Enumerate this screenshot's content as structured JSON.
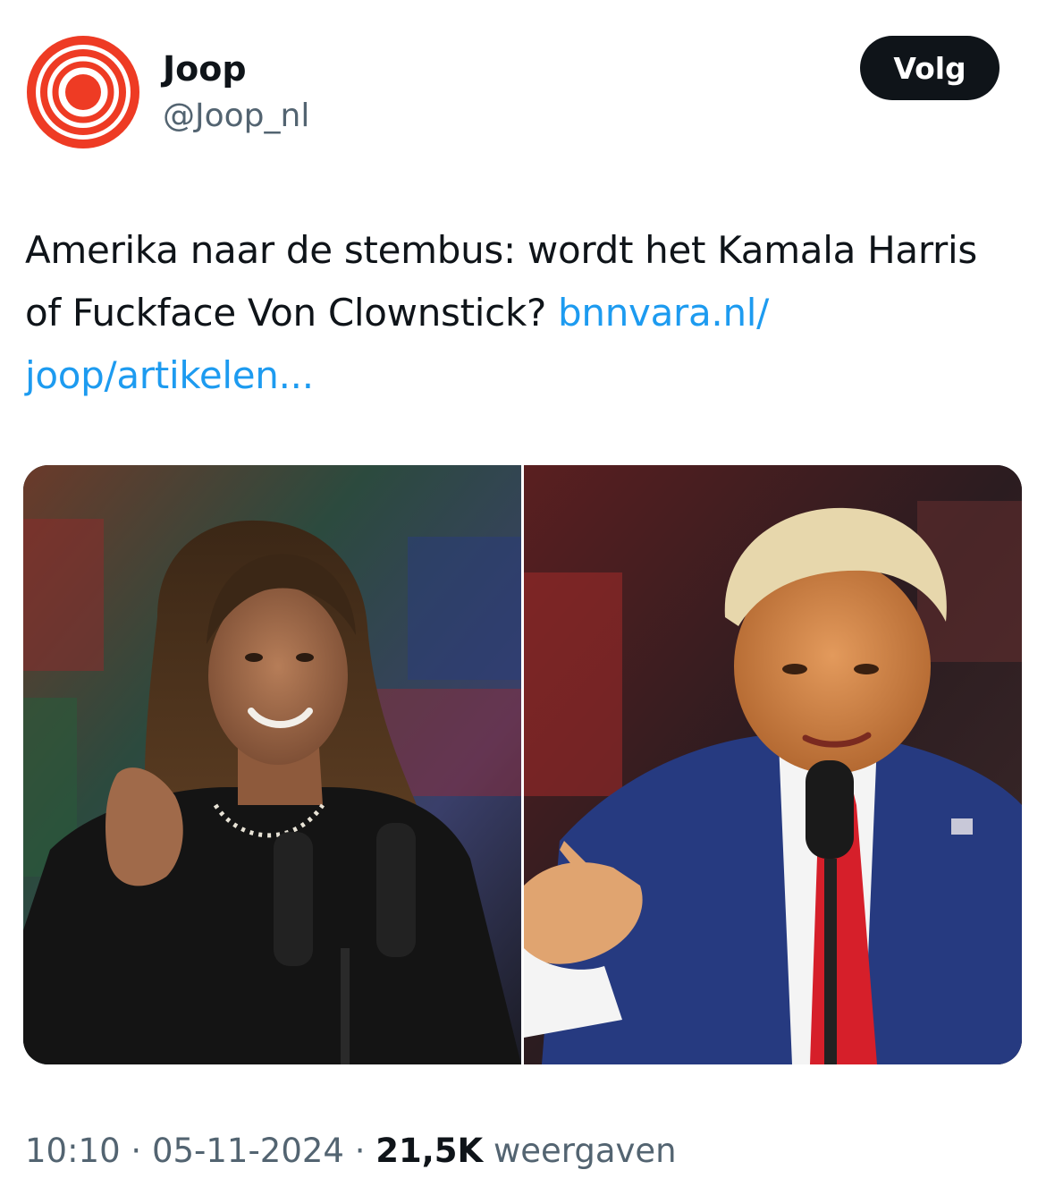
{
  "author": {
    "name": "Joop",
    "handle": "@Joop_nl",
    "avatar_icon": "joop-concentric-circles-logo",
    "avatar_color": "#ee3b24"
  },
  "follow_button": {
    "label": "Volg"
  },
  "tweet": {
    "text": "Amerika naar de stembus: wordt het Kamala Harris of Fuckface Von Clownstick? ",
    "link_text": "bnnvara.nl/​joop/artikelen...",
    "link_color": "#1d9bf0"
  },
  "media": {
    "images": [
      {
        "subject": "kamala-harris-speaking-photo"
      },
      {
        "subject": "donald-trump-pointing-photo"
      }
    ]
  },
  "meta": {
    "time": "10:10",
    "separator1": " · ",
    "date": "05-11-2024",
    "separator2": " · ",
    "views_count": "21,5K",
    "views_label": " weergaven"
  }
}
